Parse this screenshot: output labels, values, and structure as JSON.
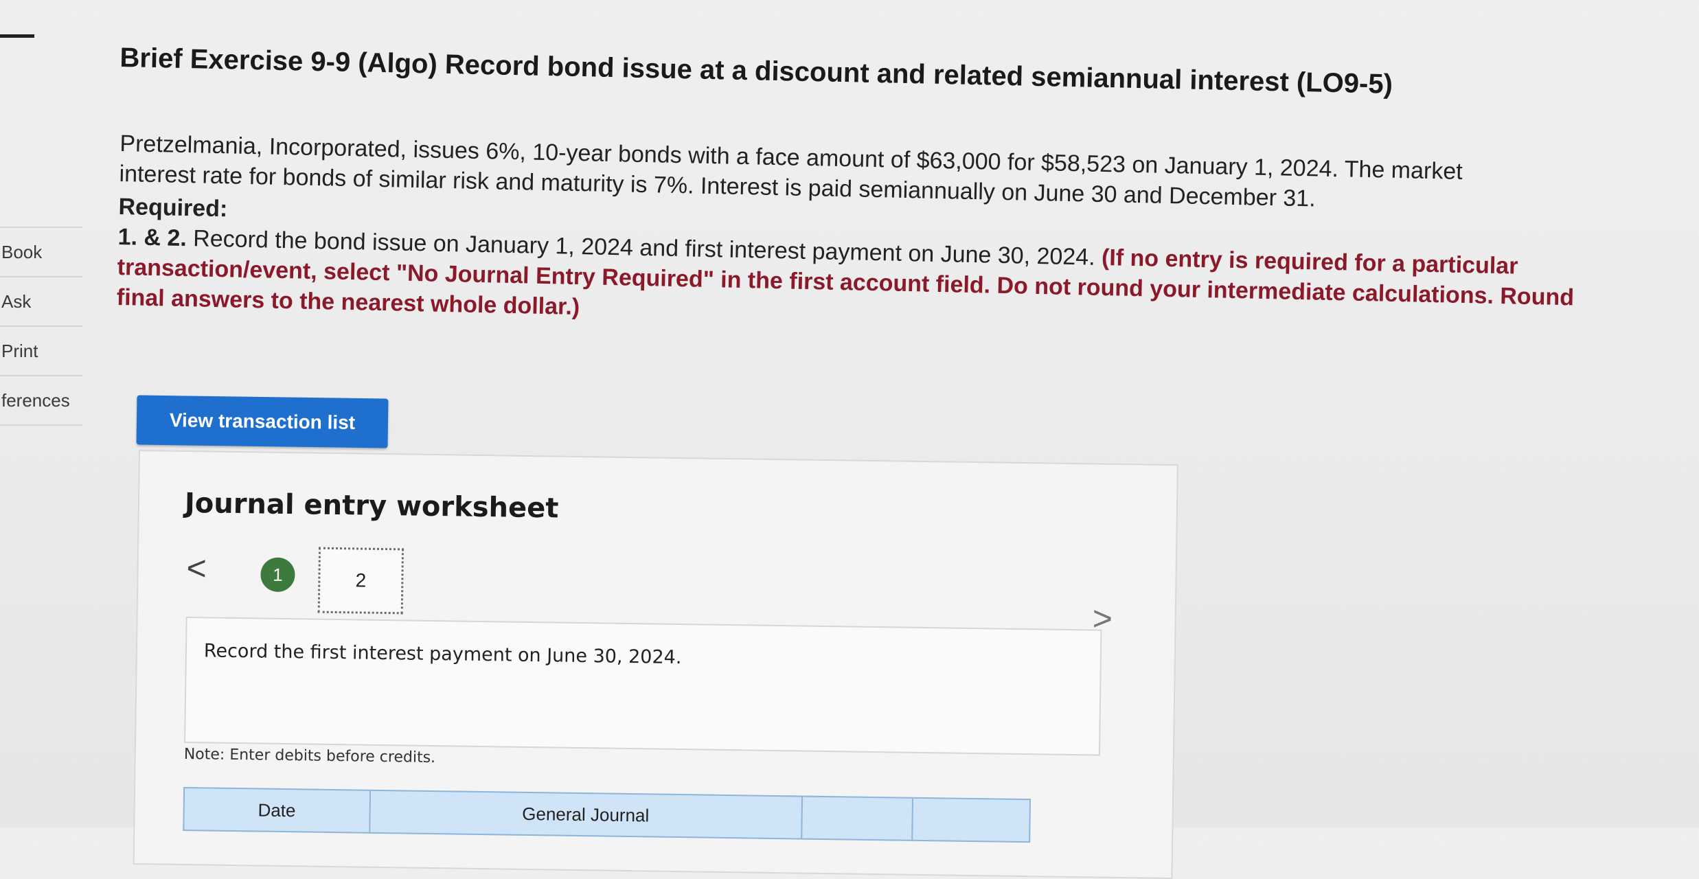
{
  "sidebar": {
    "items": [
      {
        "label": "Book"
      },
      {
        "label": "Ask"
      },
      {
        "label": "Print"
      },
      {
        "label": "ferences"
      }
    ]
  },
  "exercise": {
    "title": "Brief Exercise 9-9 (Algo) Record bond issue at a discount and related semiannual interest (LO9-5)",
    "problem_line1": "Pretzelmania, Incorporated, issues 6%, 10-year bonds with a face amount of $63,000 for $58,523 on January 1, 2024. The market",
    "problem_line2": "interest rate for bonds of similar risk and maturity is 7%. Interest is paid semiannually on June 30 and December 31.",
    "required_label": "Required:",
    "required_prefix": "1. & 2.",
    "required_text": " Record the bond issue on January 1, 2024 and first interest payment on June 30, 2024. ",
    "required_note": "(If no entry is required for a particular transaction/event, select \"No Journal Entry Required\" in the first account field. Do not round your intermediate calculations. Round final answers to the nearest whole dollar.)"
  },
  "toolbar": {
    "view_transactions_label": "View transaction list"
  },
  "worksheet": {
    "title": "Journal entry worksheet",
    "prev_glyph": "<",
    "next_glyph": ">",
    "steps": [
      "1",
      "2"
    ],
    "active_step": 1,
    "instruction": "Record the first interest payment on June 30, 2024.",
    "note": "Note: Enter debits before credits.",
    "table_headers": {
      "date": "Date",
      "general_journal": "General Journal",
      "debit": "",
      "credit": ""
    }
  },
  "colors": {
    "button_blue": "#1f6fce",
    "step_green": "#3d7a3d",
    "instruction_red": "#8a1a2a",
    "table_header_blue": "#cfe4f7"
  }
}
